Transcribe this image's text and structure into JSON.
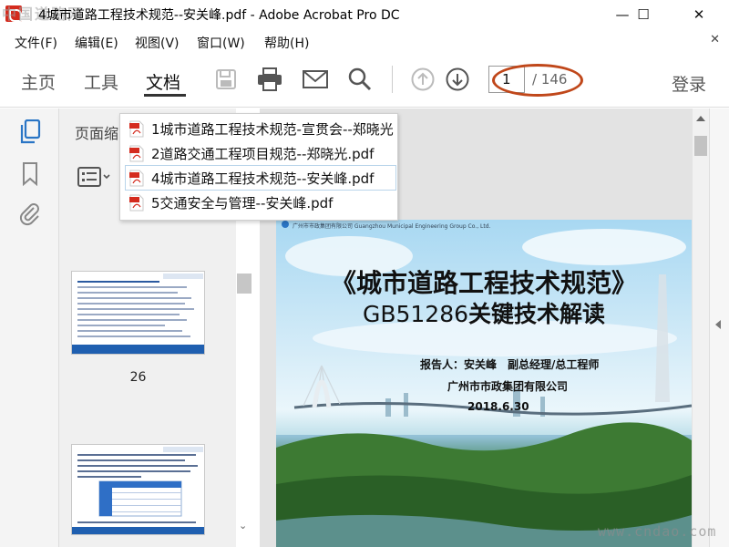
{
  "window": {
    "title": "4城市道路工程技术规范--安关峰.pdf - Adobe Acrobat Pro DC",
    "watermark_top_left": "中国道路网",
    "minimize": "—",
    "maximize": "☐",
    "close": "✕"
  },
  "menu": {
    "items": [
      "文件(F)",
      "编辑(E)",
      "视图(V)",
      "窗口(W)",
      "帮助(H)"
    ],
    "close": "✕"
  },
  "toolbar": {
    "tabs": [
      {
        "label": "主页"
      },
      {
        "label": "工具"
      },
      {
        "label": "文档"
      }
    ],
    "active_tab": "文档",
    "icons": [
      "save-icon",
      "print-icon",
      "mail-icon",
      "search-icon",
      "page-up-icon",
      "page-down-icon"
    ],
    "page_current": "1",
    "page_total": "/ 146",
    "login": "登录"
  },
  "left_rail": {
    "icons": [
      "page-thumbnails-icon",
      "bookmark-icon",
      "attachment-icon"
    ]
  },
  "thumbnails": {
    "panel_title": "页面缩略图",
    "pages": [
      {
        "label": "26"
      },
      {
        "label": ""
      }
    ]
  },
  "dropdown": {
    "items": [
      {
        "label": "1城市道路工程技术规范-宣贯会--郑晓光"
      },
      {
        "label": "2道路交通工程项目规范--郑晓光.pdf"
      },
      {
        "label": "4城市道路工程技术规范--安关峰.pdf"
      },
      {
        "label": "5交通安全与管理--安关峰.pdf"
      }
    ]
  },
  "slide": {
    "logo_text": "广州市市政集团有限公司 Guangzhou Municipal Engineering Group Co., Ltd.",
    "title": "《城市道路工程技术规范》",
    "subtitle_code": "GB51286",
    "subtitle_rest": "关键技术解读",
    "reporter": "报告人：安关峰　副总经理/总工程师",
    "org": "广州市市政集团有限公司",
    "date": "2018.6.30"
  },
  "watermark_bottom_right": "www.cndao.com",
  "colors": {
    "annotation_ellipse": "#c0471a",
    "pdf_red": "#d42b1e",
    "accent_blue": "#2a75c5"
  }
}
